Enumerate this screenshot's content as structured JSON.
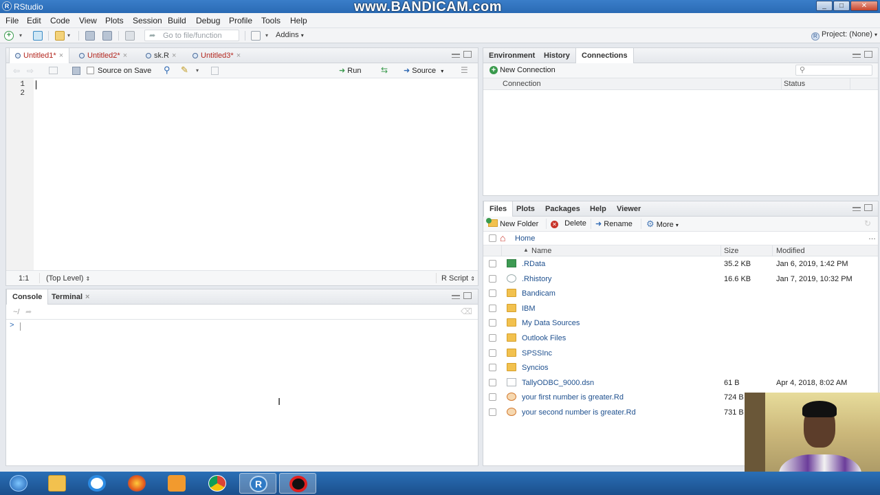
{
  "window": {
    "title": "RStudio",
    "watermark": "www.BANDICAM.com"
  },
  "menu": [
    "File",
    "Edit",
    "Code",
    "View",
    "Plots",
    "Session",
    "Build",
    "Debug",
    "Profile",
    "Tools",
    "Help"
  ],
  "toolbar": {
    "goto_placeholder": "Go to file/function",
    "addins_label": "Addins",
    "project_label": "Project: (None)"
  },
  "source": {
    "tabs": [
      {
        "label": "Untitled1*",
        "modified": true
      },
      {
        "label": "Untitled2*",
        "modified": true
      },
      {
        "label": "sk.R",
        "modified": false
      },
      {
        "label": "Untitled3*",
        "modified": true
      }
    ],
    "source_on_save_label": "Source on Save",
    "run_label": "Run",
    "source_label": "Source",
    "line_numbers": [
      "1",
      "2"
    ],
    "status": {
      "position": "1:1",
      "scope": "(Top Level)",
      "file_type": "R Script"
    }
  },
  "console": {
    "tabs": [
      "Console",
      "Terminal"
    ],
    "path": "~/",
    "prompt": ">"
  },
  "env_pane": {
    "tabs": [
      "Environment",
      "History",
      "Connections"
    ],
    "new_connection_label": "New Connection",
    "columns": [
      "Connection",
      "Status"
    ]
  },
  "files_pane": {
    "tabs": [
      "Files",
      "Plots",
      "Packages",
      "Help",
      "Viewer"
    ],
    "actions": {
      "new_folder": "New Folder",
      "delete": "Delete",
      "rename": "Rename",
      "more": "More"
    },
    "breadcrumb": "Home",
    "columns": {
      "name": "Name",
      "size": "Size",
      "modified": "Modified"
    },
    "files": [
      {
        "name": ".RData",
        "size": "35.2 KB",
        "modified": "Jan 6, 2019, 1:42 PM",
        "icon": "rdata-file-icon"
      },
      {
        "name": ".Rhistory",
        "size": "16.6 KB",
        "modified": "Jan 7, 2019, 10:32 PM",
        "icon": "rhistory-file-icon"
      },
      {
        "name": "Bandicam",
        "size": "",
        "modified": "",
        "icon": "folder-icon"
      },
      {
        "name": "IBM",
        "size": "",
        "modified": "",
        "icon": "folder-icon"
      },
      {
        "name": "My Data Sources",
        "size": "",
        "modified": "",
        "icon": "folder-icon"
      },
      {
        "name": "Outlook Files",
        "size": "",
        "modified": "",
        "icon": "folder-icon"
      },
      {
        "name": "SPSSInc",
        "size": "",
        "modified": "",
        "icon": "folder-icon"
      },
      {
        "name": "Syncios",
        "size": "",
        "modified": "",
        "icon": "folder-icon"
      },
      {
        "name": "TallyODBC_9000.dsn",
        "size": "61 B",
        "modified": "Apr 4, 2018, 8:02 AM",
        "icon": "document-file-icon"
      },
      {
        "name": "your first number is greater.Rd",
        "size": "724 B",
        "modified": "",
        "icon": "rd-file-icon"
      },
      {
        "name": "your second number is greater.Rd",
        "size": "731 B",
        "modified": "",
        "icon": "rd-file-icon"
      }
    ]
  },
  "colors": {
    "titlebar": "#2a6ab4",
    "link": "#1d4f8e",
    "modified_tab": "#b3261e",
    "taskbar": "#1b4f8c"
  }
}
